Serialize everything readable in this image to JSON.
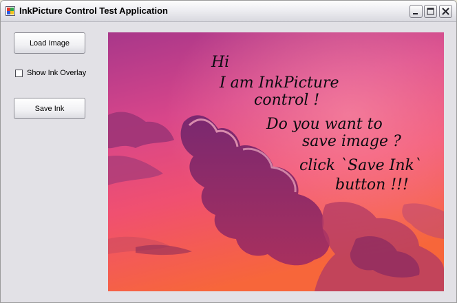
{
  "window": {
    "title": "InkPicture Control Test Application",
    "icons": {
      "app": "app-window-icon",
      "minimize": "minimize-icon",
      "maximize": "maximize-icon",
      "close": "close-icon"
    }
  },
  "controls": {
    "load_image_label": "Load Image",
    "show_ink_overlay_label": "Show Ink Overlay",
    "show_ink_overlay_checked": false,
    "save_ink_label": "Save Ink"
  },
  "ink_picture": {
    "image_description_icon": "sunset-clouds-image",
    "ink_lines": [
      "Hi",
      "I am InkPicture",
      "control !",
      "Do you want to",
      "save image ?",
      "click `Save Ink`",
      "button !!!"
    ]
  },
  "colors": {
    "sky_top": "#b43c8c",
    "sky_mid": "#e8457a",
    "sky_bottom": "#f4623a",
    "cloud": "#8a2d6a",
    "ink": "#0b0b10"
  }
}
